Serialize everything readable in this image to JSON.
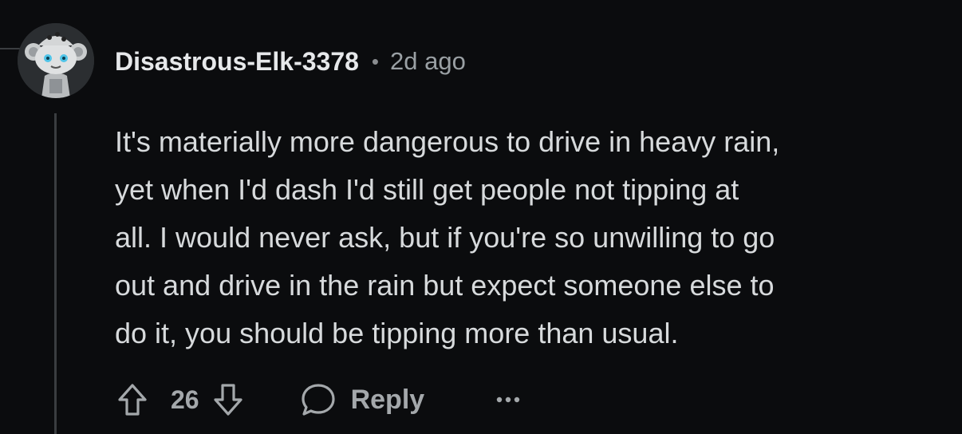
{
  "comment": {
    "username": "Disastrous-Elk-3378",
    "separator": "•",
    "timestamp": "2d ago",
    "body_lines": [
      "It's materially more dangerous to drive in heavy rain,",
      "yet when I'd dash I'd still get people not tipping at",
      "all. I would never ask, but if you're so unwilling to go",
      "out and drive in the rain but expect someone else to",
      "do it, you should be tipping more than usual."
    ],
    "score": "26",
    "reply_label": "Reply"
  },
  "icons": {
    "avatar": "snoo-avatar",
    "upvote": "upvote-arrow-icon",
    "downvote": "downvote-arrow-icon",
    "reply": "speech-bubble-icon",
    "more": "ellipsis-icon"
  },
  "colors": {
    "background": "#0b0c0e",
    "text": "#d7dadc",
    "muted": "#a4a8ab",
    "thread_line": "#3a3d40"
  }
}
